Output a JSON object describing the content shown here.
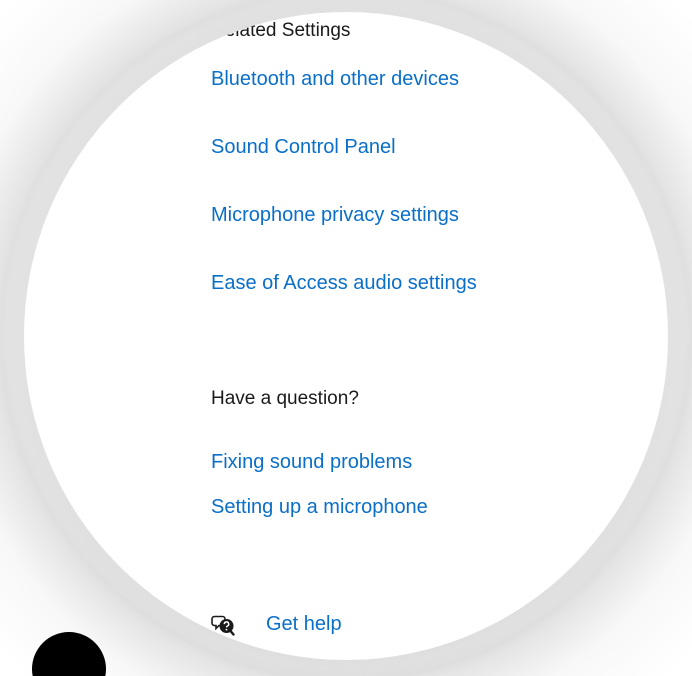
{
  "related_settings": {
    "title": "Related Settings",
    "links": [
      "Bluetooth and other devices",
      "Sound Control Panel",
      "Microphone privacy settings",
      "Ease of Access audio settings"
    ]
  },
  "help_section": {
    "title": "Have a question?",
    "links": [
      "Fixing sound problems",
      "Setting up a microphone"
    ]
  },
  "get_help": {
    "label": "Get help",
    "icon": "chat-help-icon"
  }
}
